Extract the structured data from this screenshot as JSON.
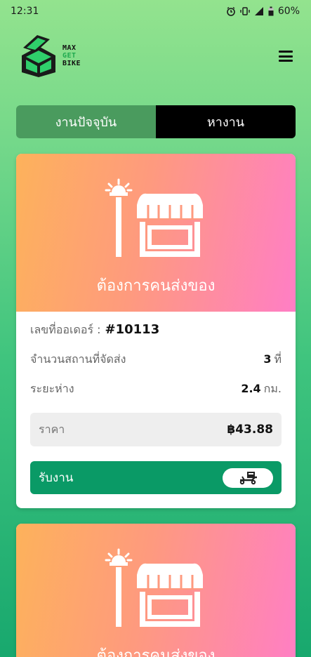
{
  "status_bar": {
    "time": "12:31",
    "battery": "60%"
  },
  "logo": {
    "line1": "MAX",
    "line2": "GET",
    "line3": "BIKE"
  },
  "tabs": [
    {
      "label": "งานปัจจุบัน",
      "active": false
    },
    {
      "label": "หางาน",
      "active": true
    }
  ],
  "cards": [
    {
      "hero_title": "ต้องการคนส่งของ",
      "order_label": "เลขที่ออเดอร์ :",
      "order_no": "#10113",
      "stops_label": "จำนวนสถานที่จัดส่ง",
      "stops_value": "3",
      "stops_unit": "ที่",
      "distance_label": "ระยะห่าง",
      "distance_value": "2.4",
      "distance_unit": "กม.",
      "price_label": "ราคา",
      "price_value": "฿43.88",
      "accept_label": "รับงาน"
    },
    {
      "hero_title": "ต้องการคนส่งของ"
    }
  ],
  "colors": {
    "accept": "#0a9a66",
    "tab_active": "#000000",
    "tab_inactive": "#4a9b5e"
  }
}
